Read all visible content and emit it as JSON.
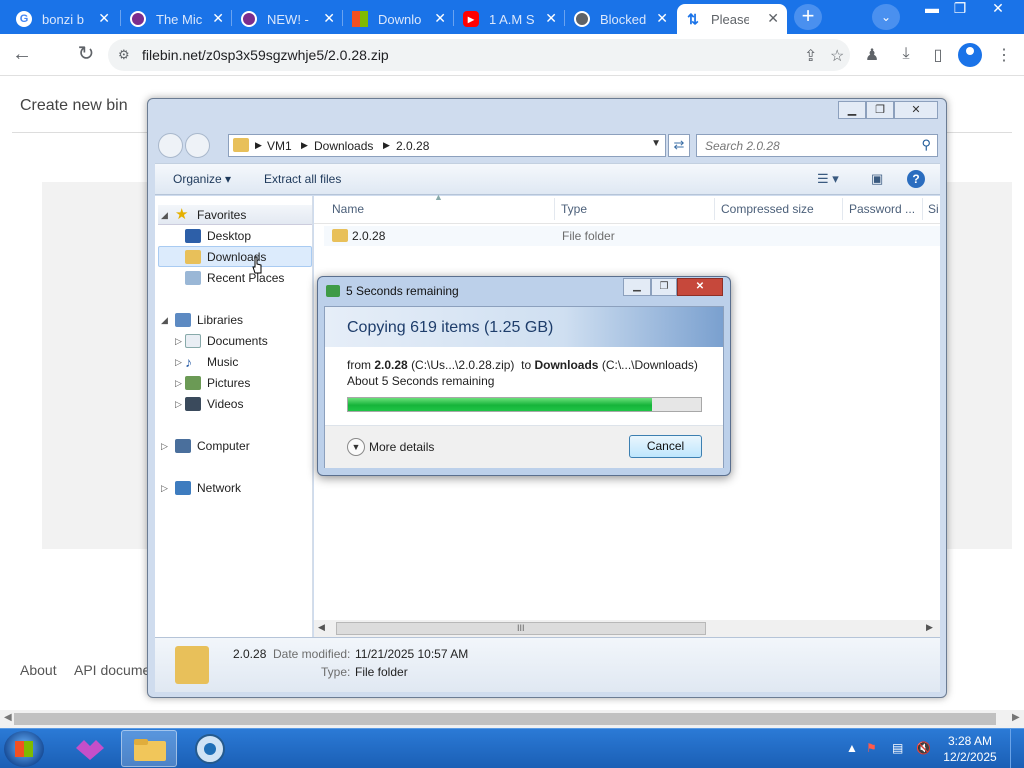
{
  "browser": {
    "tabs": [
      {
        "title": "bonzi b",
        "icon": "google-icon",
        "color": "#ffffff"
      },
      {
        "title": "The Mic",
        "icon": "purple-globe-icon",
        "color": "#7b2d8e"
      },
      {
        "title": "NEW! -",
        "icon": "purple-globe-icon",
        "color": "#7b2d8e"
      },
      {
        "title": "Downlo",
        "icon": "windows-icon",
        "color": "#f25022"
      },
      {
        "title": "1 A.M S",
        "icon": "youtube-icon",
        "color": "#ff0000"
      },
      {
        "title": "Blocked",
        "icon": "globe-icon",
        "color": "#5f6368"
      },
      {
        "title": "Please",
        "icon": "transfer-icon",
        "color": "#1a73e8"
      }
    ],
    "url": "filebin.net/z0sp3x59sgzwhje5/2.0.28.zip"
  },
  "page": {
    "create_bin": "Create new bin",
    "footer": {
      "about": "About",
      "api_docs": "API docume"
    }
  },
  "explorer": {
    "breadcrumb": [
      "VM1",
      "Downloads",
      "2.0.28"
    ],
    "search_placeholder": "Search 2.0.28",
    "toolbar": {
      "organize": "Organize",
      "extract": "Extract all files"
    },
    "nav": {
      "favorites": "Favorites",
      "desktop": "Desktop",
      "downloads": "Downloads",
      "recent": "Recent Places",
      "libraries": "Libraries",
      "documents": "Documents",
      "music": "Music",
      "pictures": "Pictures",
      "videos": "Videos",
      "computer": "Computer",
      "network": "Network"
    },
    "columns": {
      "name": "Name",
      "type": "Type",
      "compressed": "Compressed size",
      "password": "Password ...",
      "size": "Si"
    },
    "rows": [
      {
        "name": "2.0.28",
        "type": "File folder"
      }
    ],
    "details": {
      "name": "2.0.28",
      "date_label": "Date modified:",
      "date_value": "11/21/2025 10:57 AM",
      "type_label": "Type:",
      "type_value": "File folder"
    }
  },
  "copy_dialog": {
    "title": "5 Seconds remaining",
    "heading": "Copying 619 items (1.25 GB)",
    "from_word": "from",
    "src_name": "2.0.28",
    "src_path": "(C:\\Us...\\2.0.28.zip)",
    "to_word": "to",
    "dst_name": "Downloads",
    "dst_path": "(C:\\...\\Downloads)",
    "remaining": "About 5 Seconds remaining",
    "progress": 0.86,
    "more_details": "More details",
    "cancel": "Cancel"
  },
  "taskbar": {
    "time": "3:28 AM",
    "date": "12/2/2025"
  }
}
